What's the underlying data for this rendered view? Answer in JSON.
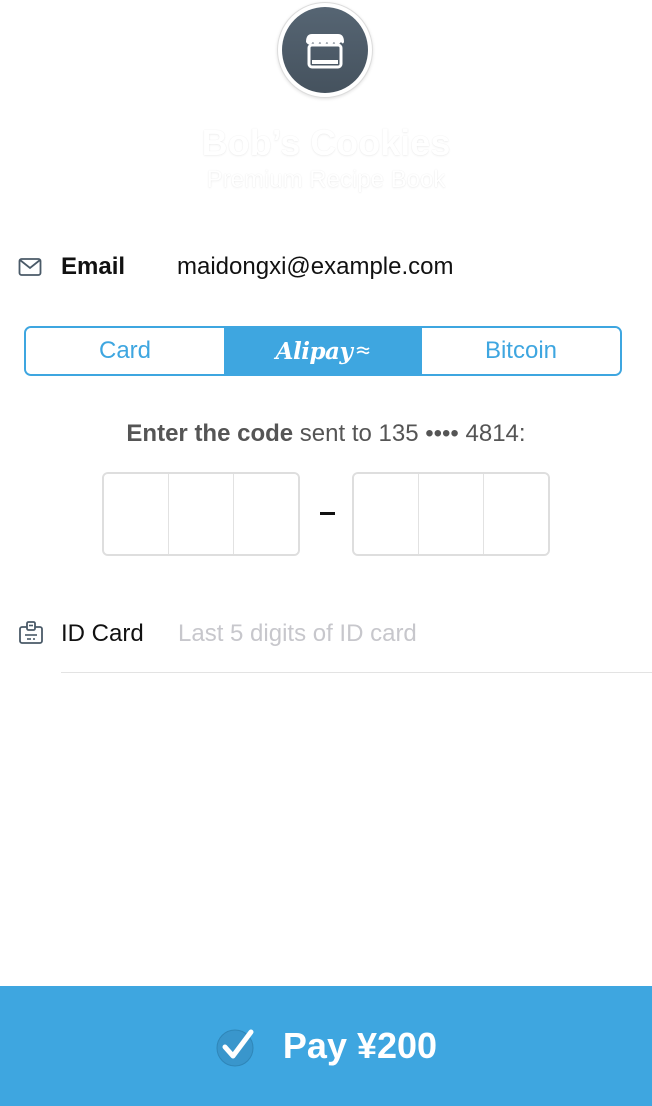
{
  "merchant": {
    "name": "Bob’s Cookies",
    "description": "Premium Recipe Book",
    "logo_icon": "storefront-icon"
  },
  "email": {
    "label": "Email",
    "value": "maidongxi@example.com",
    "icon": "envelope-icon"
  },
  "payment_tabs": [
    {
      "label": "Card",
      "active": false
    },
    {
      "label": "Alipay",
      "active": true
    },
    {
      "label": "Bitcoin",
      "active": false
    }
  ],
  "code_entry": {
    "prompt_bold": "Enter the code",
    "prompt_rest": " sent to 135 •••• 4814:",
    "groups": 2,
    "digits_per_group": 3
  },
  "id_card": {
    "label": "ID Card",
    "placeholder": "Last 5 digits of ID card",
    "value": "",
    "icon": "id-badge-icon"
  },
  "pay_button": {
    "label": "Pay ¥200",
    "icon": "checkmark-icon"
  },
  "colors": {
    "accent": "#3ea6e0",
    "logo_bg": "#4e5b68",
    "placeholder": "#c7c7cc"
  }
}
